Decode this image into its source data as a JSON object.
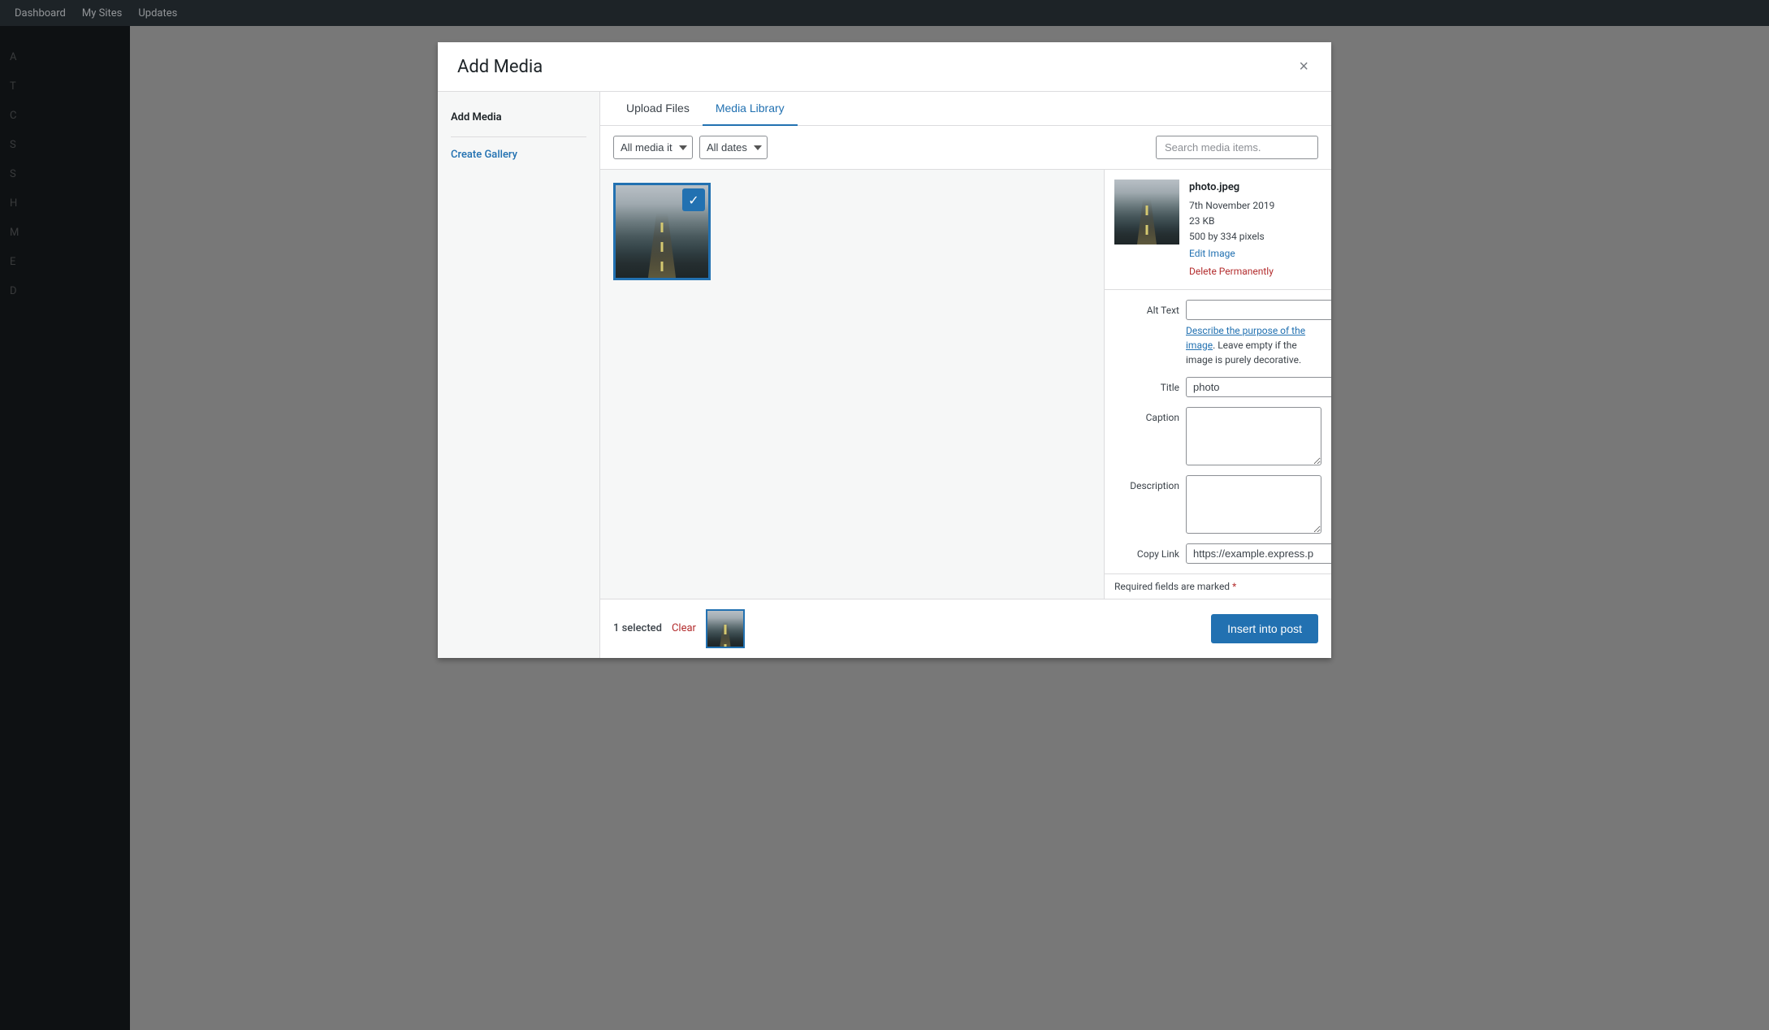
{
  "adminBar": {
    "items": [
      "Dashboard",
      "My Sites",
      "Updates"
    ]
  },
  "modal": {
    "title": "Add Media",
    "closeLabel": "×",
    "sidebar": {
      "sectionTitle": "Add Media",
      "items": [
        {
          "label": "Create Gallery",
          "active": false
        },
        {
          "label": "Upload Files",
          "active": false
        },
        {
          "label": "Media Library",
          "active": true
        }
      ]
    },
    "tabs": [
      {
        "label": "Upload Files",
        "active": false
      },
      {
        "label": "Media Library",
        "active": true
      }
    ],
    "filters": {
      "mediaType": "All media it",
      "date": "All dates",
      "searchPlaceholder": "Search media items."
    },
    "detailPanel": {
      "filename": "photo.jpeg",
      "date": "7th November 2019",
      "filesize": "23 KB",
      "dimensions": "500 by 334 pixels",
      "editImageLabel": "Edit Image",
      "deleteLabel": "Delete Permanently",
      "fields": {
        "altText": {
          "label": "Alt Text",
          "value": "",
          "hintLinkText": "Describe the purpose of the image",
          "hintText": ". Leave empty if the image is purely decorative."
        },
        "title": {
          "label": "Title",
          "value": "photo"
        },
        "caption": {
          "label": "Caption",
          "value": ""
        },
        "description": {
          "label": "Description",
          "value": ""
        },
        "copyLink": {
          "label": "Copy Link",
          "value": "https://example.express.p"
        }
      },
      "requiredNote": "Required fields are marked",
      "requiredSymbol": "*"
    },
    "footer": {
      "selectedCount": "1 selected",
      "clearLabel": "Clear",
      "insertButton": "Insert into post"
    }
  }
}
